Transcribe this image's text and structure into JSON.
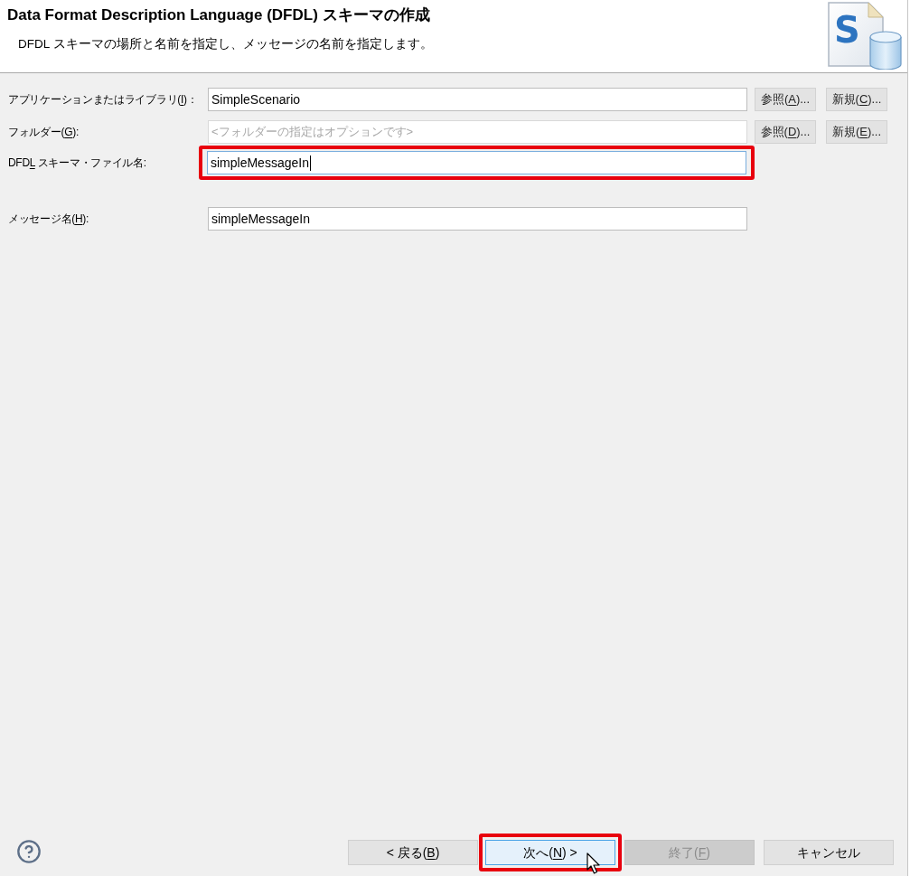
{
  "header": {
    "title": "Data Format Description Language (DFDL) スキーマの作成",
    "description": "DFDL スキーマの場所と名前を指定し、メッセージの名前を指定します。",
    "icon_letter": "S"
  },
  "location_fields": [
    {
      "label": {
        "pre": "アプリケーションまたはライブラリ(",
        "access_key": "I",
        "post": ")："
      },
      "value": "SimpleScenario",
      "focused": false,
      "highlighted": false,
      "buttons": [
        {
          "pre": "参照(",
          "access_key": "A",
          "post": ")..."
        },
        {
          "pre": "新規(",
          "access_key": "C",
          "post": ")..."
        }
      ]
    },
    {
      "label": {
        "pre": "フォルダー(",
        "access_key": "G",
        "post": "):"
      },
      "placeholder": "<フォルダーの指定はオプションです>",
      "focused": false,
      "highlighted": false,
      "buttons": [
        {
          "pre": "参照(",
          "access_key": "D",
          "post": ")..."
        },
        {
          "pre": "新規(",
          "access_key": "E",
          "post": ")..."
        }
      ]
    },
    {
      "label": {
        "pre": "DFD",
        "access_key": "L",
        "post": " スキーマ・ファイル名:"
      },
      "value": "simpleMessageIn",
      "focused": true,
      "highlighted": true
    }
  ],
  "message_field": {
    "label": {
      "pre": "メッセージ名(",
      "access_key": "H",
      "post": "):"
    },
    "value": "simpleMessageIn",
    "focused": false,
    "highlighted": false
  },
  "footer_buttons": [
    {
      "label": {
        "pre": "< 戻る(",
        "access_key": "B",
        "post": ")"
      },
      "disabled": false,
      "hovered": false,
      "highlighted": false
    },
    {
      "label": {
        "pre": "次へ(",
        "access_key": "N",
        "post": ") >"
      },
      "disabled": false,
      "hovered": true,
      "highlighted": true
    },
    {
      "label": {
        "pre": "終了(",
        "access_key": "F",
        "post": ")"
      },
      "disabled": true,
      "hovered": false,
      "highlighted": false
    },
    {
      "label": {
        "pre": "キャンセル"
      },
      "disabled": false,
      "hovered": false,
      "highlighted": false
    }
  ]
}
